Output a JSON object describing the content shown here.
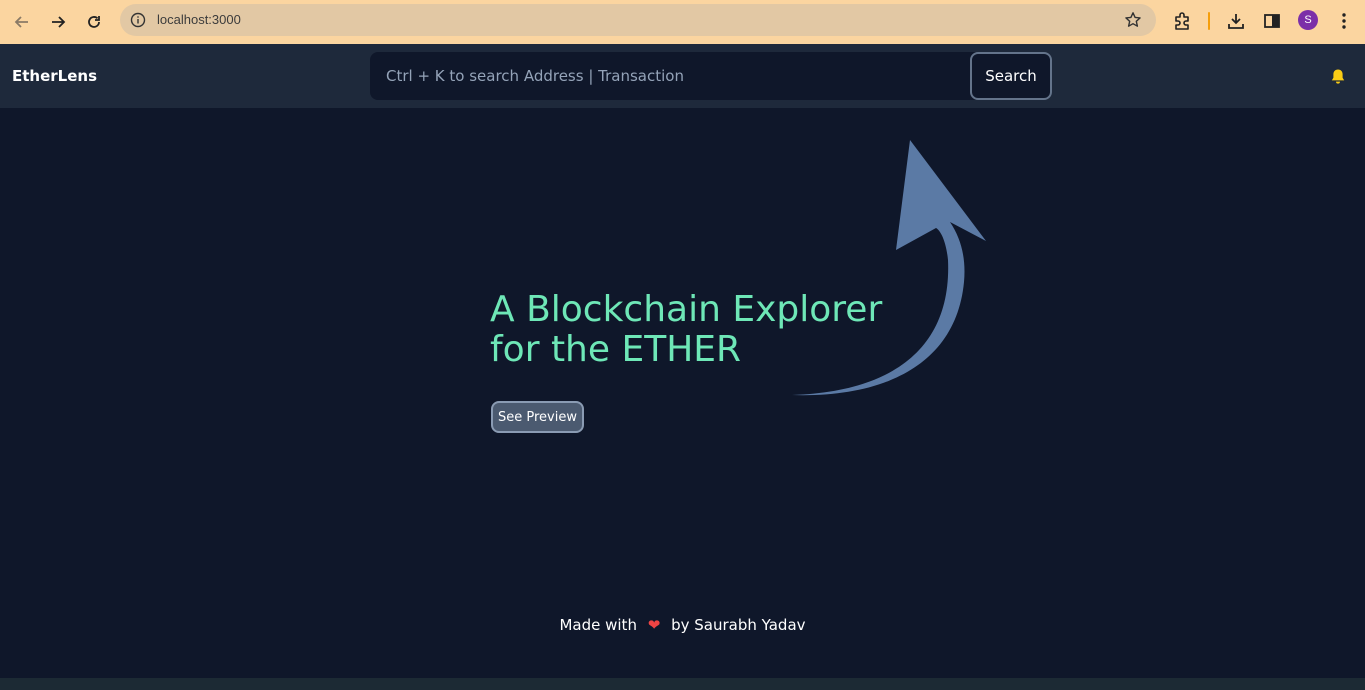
{
  "browser": {
    "url": "localhost:3000",
    "profile_initial": "S"
  },
  "header": {
    "brand": "EtherLens",
    "search_placeholder": "Ctrl + K to search Address | Transaction",
    "search_button": "Search"
  },
  "hero": {
    "title_line1": "A Blockchain Explorer",
    "title_line2": "for the ETHER",
    "preview_button": "See Preview"
  },
  "footer": {
    "text_before": "Made with",
    "heart": "❤",
    "text_after": "by Saurabh Yadav"
  },
  "colors": {
    "page_bg": "#0f172a",
    "header_bg": "#1e293b",
    "accent_title": "#6ee7b7",
    "arrow": "#5b7aa5",
    "bell": "#facc15",
    "chrome_bg": "#fbd5a0"
  },
  "icons": [
    "back-icon",
    "forward-icon",
    "reload-icon",
    "site-info-icon",
    "bookmark-star-icon",
    "extensions-icon",
    "download-icon",
    "side-panel-icon",
    "menu-icon",
    "bell-icon",
    "heart-icon",
    "arrow-icon"
  ]
}
